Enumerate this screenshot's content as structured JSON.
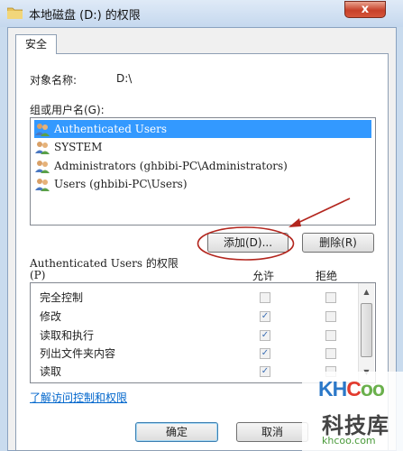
{
  "window": {
    "title": "本地磁盘 (D:) 的权限",
    "close_glyph": "x",
    "icon": "folder-icon"
  },
  "tab": {
    "label": "安全"
  },
  "object": {
    "label": "对象名称:",
    "value": "D:\\"
  },
  "group": {
    "label": "组或用户名(G):",
    "users": [
      {
        "name": "Authenticated Users",
        "icon": "users-group-icon",
        "selected": true
      },
      {
        "name": "SYSTEM",
        "icon": "users-group-icon",
        "selected": false
      },
      {
        "name": "Administrators (ghbibi-PC\\Administrators)",
        "icon": "users-group-icon",
        "selected": false
      },
      {
        "name": "Users (ghbibi-PC\\Users)",
        "icon": "users-group-icon",
        "selected": false
      }
    ]
  },
  "buttons": {
    "add": "添加(D)...",
    "remove": "删除(R)",
    "ok": "确定",
    "cancel": "取消"
  },
  "permissions": {
    "title": "Authenticated Users 的权限",
    "title_suffix": "(P)",
    "allow_header": "允许",
    "deny_header": "拒绝",
    "rows": [
      {
        "label": "完全控制",
        "allow": false,
        "deny": false
      },
      {
        "label": "修改",
        "allow": true,
        "deny": false
      },
      {
        "label": "读取和执行",
        "allow": true,
        "deny": false
      },
      {
        "label": "列出文件夹内容",
        "allow": true,
        "deny": false
      },
      {
        "label": "读取",
        "allow": true,
        "deny": false
      }
    ]
  },
  "link": "了解访问控制和权限",
  "watermark": {
    "logo": "KHCoo",
    "name": "科技库",
    "url": "khcoo.com"
  },
  "colors": {
    "selection": "#3399ff",
    "annotation": "#b3261e",
    "link": "#0066cc"
  }
}
